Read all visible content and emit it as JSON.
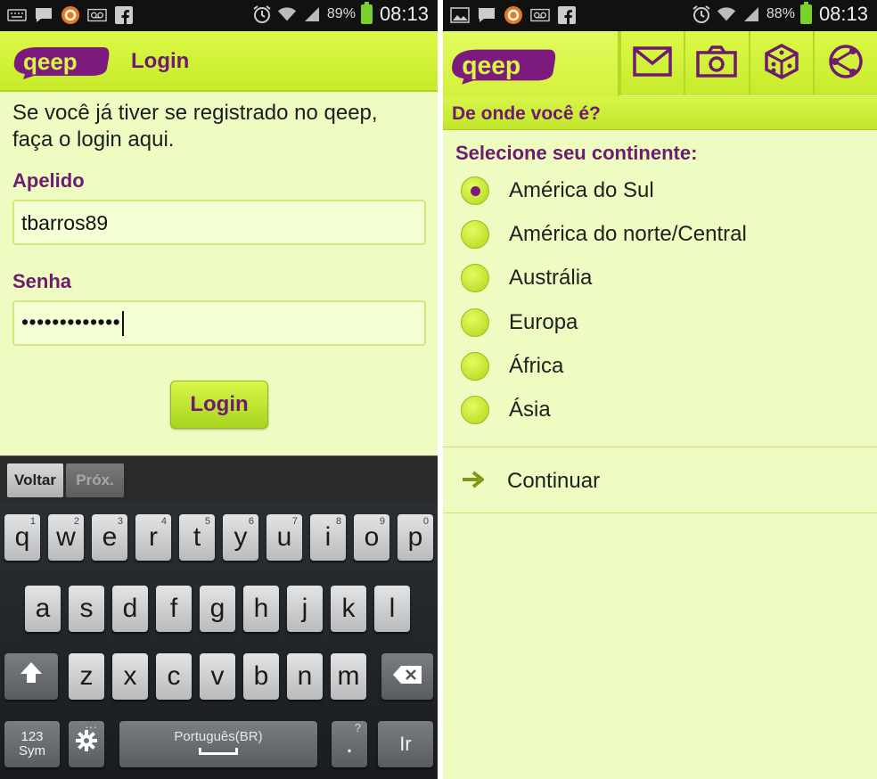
{
  "status_left": {
    "battery_pct": "89%",
    "time": "08:13"
  },
  "status_right": {
    "battery_pct": "88%",
    "time": "08:13"
  },
  "app": {
    "logo_text": "qeep"
  },
  "login": {
    "title": "Login",
    "intro": "Se você já tiver se registrado no qeep, faça o login aqui.",
    "nickname_label": "Apelido",
    "nickname_value": "tbarros89",
    "password_label": "Senha",
    "password_value": "•••••••••••••",
    "login_button": "Login"
  },
  "keyboard": {
    "back": "Voltar",
    "next": "Próx.",
    "row1": [
      {
        "k": "q",
        "n": "1"
      },
      {
        "k": "w",
        "n": "2"
      },
      {
        "k": "e",
        "n": "3"
      },
      {
        "k": "r",
        "n": "4"
      },
      {
        "k": "t",
        "n": "5"
      },
      {
        "k": "y",
        "n": "6"
      },
      {
        "k": "u",
        "n": "7"
      },
      {
        "k": "i",
        "n": "8"
      },
      {
        "k": "o",
        "n": "9"
      },
      {
        "k": "p",
        "n": "0"
      }
    ],
    "row2": [
      "a",
      "s",
      "d",
      "f",
      "g",
      "h",
      "j",
      "k",
      "l"
    ],
    "row3": [
      "z",
      "x",
      "c",
      "v",
      "b",
      "n",
      "m"
    ],
    "sym_line1": "123",
    "sym_line2": "Sym",
    "space_label": "Português(BR)",
    "period_hint": "?",
    "period": ".",
    "go": "Ir"
  },
  "continent": {
    "section_title": "De onde você é?",
    "select_label": "Selecione seu continente:",
    "options": [
      "América do Sul",
      "América do norte/Central",
      "Austrália",
      "Europa",
      "África",
      "Ásia"
    ],
    "selected_index": 0,
    "continue_label": "Continuar"
  },
  "colors": {
    "brand_green": "#d4f23d",
    "brand_purple": "#6e1b6f",
    "background": "#eefcc2"
  },
  "icons": [
    "keyboard-icon",
    "chat-icon",
    "avast-icon",
    "voicemail-icon",
    "facebook-icon",
    "image-icon",
    "alarm-icon",
    "wifi-icon",
    "signal-icon",
    "battery-icon",
    "mail-icon",
    "camera-icon",
    "dice-icon",
    "share-icon",
    "arrow-right-icon",
    "shift-icon",
    "backspace-icon",
    "settings-icon"
  ]
}
